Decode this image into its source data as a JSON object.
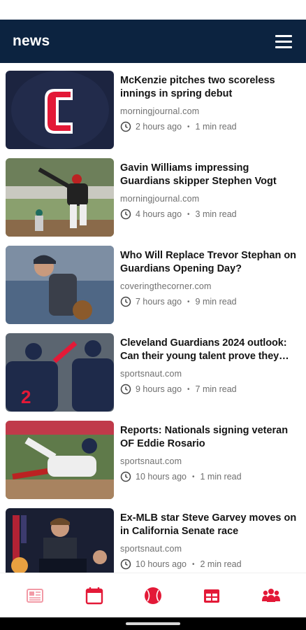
{
  "header": {
    "title": "news"
  },
  "colors": {
    "navy": "#0c2340",
    "accent_red": "#e31937",
    "muted_red": "#f29aa6"
  },
  "articles": [
    {
      "headline": "McKenzie pitches two scoreless innings in spring debut",
      "source": "morningjournal.com",
      "time": "2 hours ago",
      "read": "1 min read",
      "image": "cleveland-cap-logo"
    },
    {
      "headline": "Gavin Williams impressing Guardians skipper Stephen Vogt",
      "source": "morningjournal.com",
      "time": "4 hours ago",
      "read": "3 min read",
      "image": "pitcher-throwing"
    },
    {
      "headline": "Who Will Replace Trevor Stephan on Guardians Opening Day?",
      "source": "coveringthecorner.com",
      "time": "7 hours ago",
      "read": "9 min read",
      "image": "pitcher-in-dugout"
    },
    {
      "headline": "Cleveland Guardians 2024 outlook: Can their young talent prove they ca...",
      "source": "sportsnaut.com",
      "time": "9 hours ago",
      "read": "7 min read",
      "image": "players-celebrating"
    },
    {
      "headline": "Reports: Nationals signing veteran OF Eddie Rosario",
      "source": "sportsnaut.com",
      "time": "10 hours ago",
      "read": "1 min read",
      "image": "player-sliding"
    },
    {
      "headline": "Ex-MLB star Steve Garvey moves on in California Senate race",
      "source": "sportsnaut.com",
      "time": "10 hours ago",
      "read": "2 min read",
      "image": "politician-at-podium"
    }
  ],
  "bottom_nav": [
    {
      "name": "news",
      "icon": "newspaper-icon",
      "active": true
    },
    {
      "name": "schedule",
      "icon": "calendar-icon",
      "active": false
    },
    {
      "name": "scores",
      "icon": "baseball-icon",
      "active": false
    },
    {
      "name": "standings",
      "icon": "table-icon",
      "active": false
    },
    {
      "name": "roster",
      "icon": "team-icon",
      "active": false
    }
  ]
}
